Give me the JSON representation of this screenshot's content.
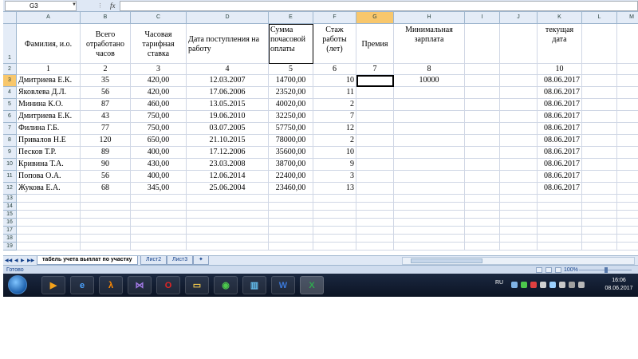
{
  "formula_bar": {
    "name_box": "G3",
    "fx": "fx",
    "formula": ""
  },
  "columns": [
    "A",
    "B",
    "C",
    "D",
    "E",
    "F",
    "G",
    "H",
    "I",
    "J",
    "K",
    "L",
    "M"
  ],
  "headers": {
    "A": "Фамилия, и.о.",
    "B": "Всего отработано часов",
    "C": "Часовая тарифная ставка",
    "D": "Дата поступления на работу",
    "E": "Сумма почасовой оплаты",
    "F": "Стаж работы (лет)",
    "G": "Премия",
    "H": "Минимальная зарплата",
    "K": "текущая дата"
  },
  "numbers_row": {
    "A": "1",
    "B": "2",
    "C": "3",
    "D": "4",
    "E": "5",
    "F": "6",
    "G": "7",
    "H": "8",
    "K": "10"
  },
  "min_salary": "10000",
  "rows": [
    {
      "name": "Дмитриева Е.К.",
      "hours": "35",
      "rate": "420,00",
      "date": "12.03.2007",
      "sum": "14700,00",
      "exp": "10",
      "cur": "08.06.2017"
    },
    {
      "name": "Яковлева Д.Л.",
      "hours": "56",
      "rate": "420,00",
      "date": "17.06.2006",
      "sum": "23520,00",
      "exp": "11",
      "cur": "08.06.2017"
    },
    {
      "name": "Минина К.О.",
      "hours": "87",
      "rate": "460,00",
      "date": "13.05.2015",
      "sum": "40020,00",
      "exp": "2",
      "cur": "08.06.2017"
    },
    {
      "name": "Дмитриева Е.К.",
      "hours": "43",
      "rate": "750,00",
      "date": "19.06.2010",
      "sum": "32250,00",
      "exp": "7",
      "cur": "08.06.2017"
    },
    {
      "name": "Филина Г.Б.",
      "hours": "77",
      "rate": "750,00",
      "date": "03.07.2005",
      "sum": "57750,00",
      "exp": "12",
      "cur": "08.06.2017"
    },
    {
      "name": "Привалов Н.Е",
      "hours": "120",
      "rate": "650,00",
      "date": "21.10.2015",
      "sum": "78000,00",
      "exp": "2",
      "cur": "08.06.2017"
    },
    {
      "name": "Песков Т.Р.",
      "hours": "89",
      "rate": "400,00",
      "date": "17.12.2006",
      "sum": "35600,00",
      "exp": "10",
      "cur": "08.06.2017"
    },
    {
      "name": "Кривина Т.А.",
      "hours": "90",
      "rate": "430,00",
      "date": "23.03.2008",
      "sum": "38700,00",
      "exp": "9",
      "cur": "08.06.2017"
    },
    {
      "name": "Попова О.А.",
      "hours": "56",
      "rate": "400,00",
      "date": "12.06.2014",
      "sum": "22400,00",
      "exp": "3",
      "cur": "08.06.2017"
    },
    {
      "name": "Жукова Е.А.",
      "hours": "68",
      "rate": "345,00",
      "date": "25.06.2004",
      "sum": "23460,00",
      "exp": "13",
      "cur": "08.06.2017"
    }
  ],
  "row_numbers": [
    "1",
    "2",
    "3",
    "4",
    "5",
    "6",
    "7",
    "8",
    "9",
    "10",
    "11",
    "12",
    "13",
    "14",
    "15",
    "16",
    "17",
    "18",
    "19"
  ],
  "sheet_tabs": [
    "табель учета выплат по участку",
    "Лист2",
    "Лист3"
  ],
  "status": {
    "ready": "Готово",
    "zoom": "100%"
  },
  "taskbar": {
    "lang": "RU",
    "time": "16:06",
    "date": "08.06.2017"
  },
  "colors": {
    "header_bg": "#e4ecf7",
    "active_header": "#f8c76c",
    "grid_line": "#d0d7e5",
    "taskbar": "#0c1424"
  }
}
